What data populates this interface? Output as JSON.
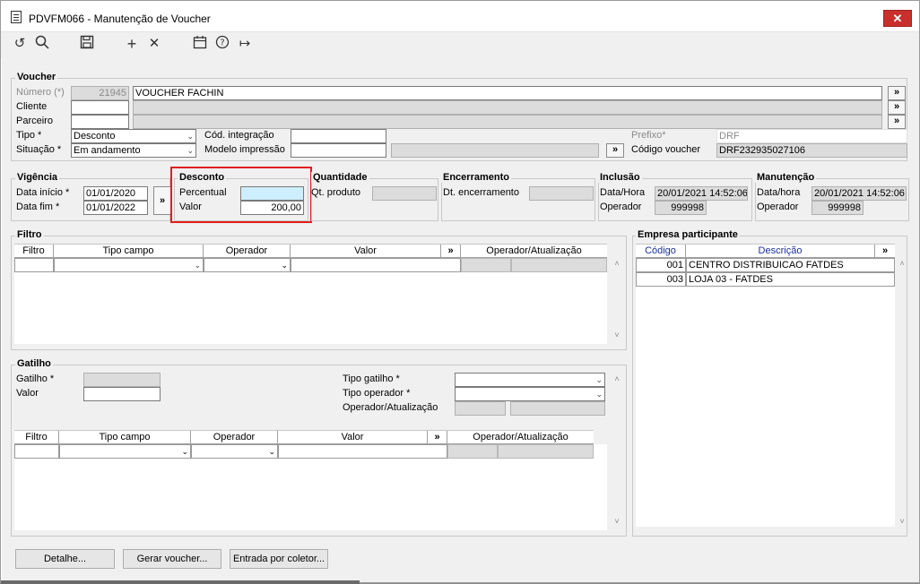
{
  "window": {
    "title": "PDVFM066 - Manutenção de Voucher",
    "close_glyph": "✕"
  },
  "toolbar": {
    "undo_glyph": "↺",
    "search_glyph": "○",
    "save_glyph": "▣",
    "add_glyph": "+",
    "delete_glyph": "✕",
    "calendar_glyph": "▦",
    "help_glyph": "?",
    "exit_glyph": "↦"
  },
  "voucher": {
    "title": "Voucher",
    "numero_label": "Número (*)",
    "numero_value": "21945",
    "descricao_value": "VOUCHER FACHIN",
    "cliente_label": "Cliente",
    "cliente_value": "",
    "cliente_desc": "",
    "parceiro_label": "Parceiro",
    "parceiro_value": "",
    "parceiro_desc": "",
    "tipo_label": "Tipo *",
    "tipo_value": "Desconto",
    "situacao_label": "Situação *",
    "situacao_value": "Em andamento",
    "cod_integracao_label": "Cód. integração",
    "cod_integracao_value": "",
    "modelo_impressao_label": "Modelo impressão",
    "modelo_impressao_value": "",
    "modelo_impressao_desc": "",
    "prefixo_label": "Prefixo*",
    "prefixo_value": "DRF",
    "codigo_voucher_label": "Código voucher",
    "codigo_voucher_value": "DRF232935027106",
    "lookup_glyph": "»"
  },
  "vigencia": {
    "title": "Vigência",
    "inicio_label": "Data início *",
    "inicio_value": "01/01/2020",
    "fim_label": "Data fim *",
    "fim_value": "01/01/2022",
    "lookup_glyph": "»"
  },
  "desconto": {
    "title": "Desconto",
    "percentual_label": "Percentual",
    "percentual_value": "",
    "valor_label": "Valor",
    "valor_value": "200,00"
  },
  "quantidade": {
    "title": "Quantidade",
    "qt_produto_label": "Qt. produto",
    "qt_produto_value": ""
  },
  "encerramento": {
    "title": "Encerramento",
    "dt_label": "Dt. encerramento",
    "dt_value": ""
  },
  "inclusao": {
    "title": "Inclusão",
    "datahora_label": "Data/Hora",
    "datahora_value": "20/01/2021 14:52:06",
    "operador_label": "Operador",
    "operador_value": "999998"
  },
  "manutencao": {
    "title": "Manutenção",
    "datahora_label": "Data/hora",
    "datahora_value": "20/01/2021 14:52:06",
    "operador_label": "Operador",
    "operador_value": "999998"
  },
  "filtro": {
    "title": "Filtro",
    "columns": [
      "Filtro",
      "Tipo campo",
      "Operador",
      "Valor",
      "»",
      "Operador/Atualização"
    ]
  },
  "gatilho": {
    "title": "Gatilho",
    "gatilho_label": "Gatilho *",
    "gatilho_value": "",
    "valor_label": "Valor",
    "valor_value": "",
    "tipo_gatilho_label": "Tipo gatilho *",
    "tipo_gatilho_value": "",
    "tipo_operador_label": "Tipo operador *",
    "tipo_operador_value": "",
    "operador_atualizacao_label": "Operador/Atualização",
    "columns": [
      "Filtro",
      "Tipo campo",
      "Operador",
      "Valor",
      "»",
      "Operador/Atualização"
    ]
  },
  "empresa": {
    "title": "Empresa participante",
    "columns": [
      "Código",
      "Descrição",
      "»"
    ],
    "rows": [
      {
        "codigo": "001",
        "descricao": "CENTRO DISTRIBUICAO FATDES"
      },
      {
        "codigo": "003",
        "descricao": "LOJA 03 - FATDES"
      }
    ]
  },
  "buttons": {
    "detalhe": "Detalhe...",
    "gerar": "Gerar voucher...",
    "coletor": "Entrada por coletor..."
  },
  "scroll": {
    "up": "˄",
    "down": "˅"
  }
}
